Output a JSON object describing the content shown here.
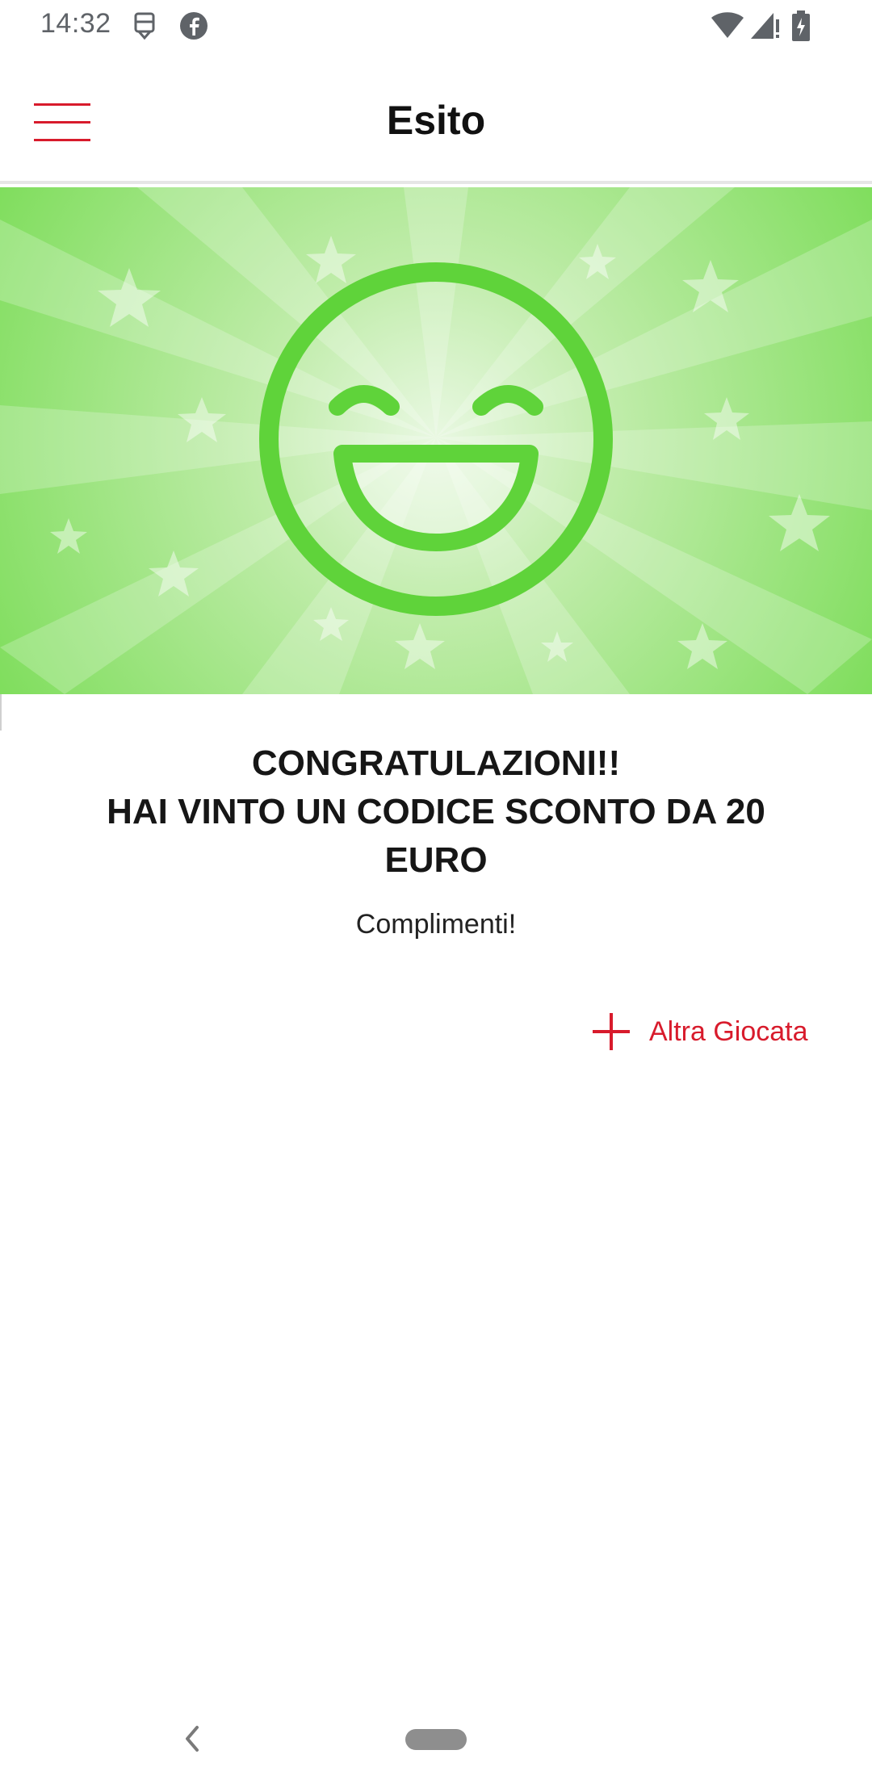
{
  "status_bar": {
    "time": "14:32",
    "icons": [
      "notification-app-icon",
      "facebook-icon",
      "wifi-icon",
      "signal-icon",
      "battery-icon"
    ]
  },
  "app_bar": {
    "title": "Esito",
    "menu_icon": "hamburger-menu-icon"
  },
  "banner": {
    "image": "smiley-face-illustration",
    "colors": {
      "background": "#7ddd5a",
      "face": "#5fd33a"
    }
  },
  "result": {
    "title_line1": "CONGRATULAZIONI!!",
    "title_line2": "HAI VINTO UN CODICE SCONTO DA 20",
    "title_line3": "EURO",
    "subtitle": "Complimenti!"
  },
  "actions": {
    "play_again_label": "Altra Giocata",
    "play_again_icon": "plus-icon"
  },
  "navigation": {
    "back_icon": "back-chevron-icon",
    "home_icon": "home-pill-icon"
  },
  "colors": {
    "accent": "#d81b2c"
  }
}
